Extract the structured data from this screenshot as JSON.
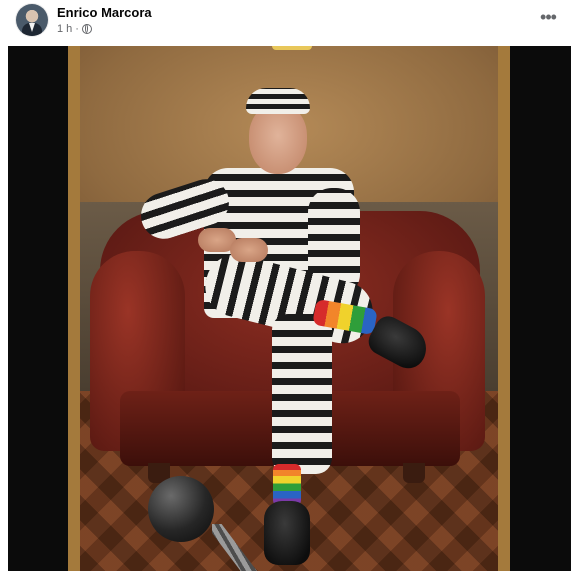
{
  "post": {
    "author_name": "Enrico Marcora",
    "timestamp": "1 h",
    "more_label": "•••",
    "avatar_icon": "avatar-icon",
    "audience_icon": "globe-icon"
  }
}
